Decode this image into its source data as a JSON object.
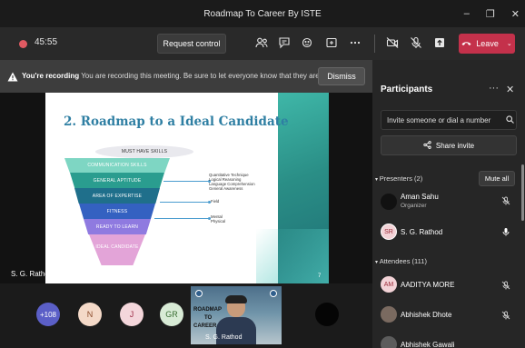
{
  "window": {
    "title": "Roadmap To Career By ISTE",
    "controls": [
      "–",
      "❐",
      "✕"
    ]
  },
  "toolbar": {
    "timer": "45:55",
    "request_control": "Request control",
    "leave_label": "Leave",
    "icons": [
      "participants-icon",
      "chat-icon",
      "reactions-icon",
      "share-tray-icon",
      "more-icon",
      "camera-off-icon",
      "mic-off-icon",
      "share-icon"
    ]
  },
  "banner": {
    "bold": "You're recording",
    "text": " You are recording this meeting. Be sure to let everyone know that they are...",
    "dismiss": "Dismiss"
  },
  "slide": {
    "title": "2. Roadmap to a Ideal Candidate",
    "page": "7",
    "funnel": [
      "MUST HAVE SKILLS",
      "COMMUNICATION SKILLS",
      "GENERAL APTITUDE",
      "AREA OF EXPERTISE",
      "FITNESS",
      "READY TO LEARN",
      "IDEAL CANDIDATE"
    ],
    "notes": [
      [
        "Quantitative Technique",
        "Logical Reasoning",
        "Language Comprehension",
        "General Awareness"
      ],
      [
        "Field"
      ],
      [
        "Mental",
        "Physical"
      ]
    ]
  },
  "stage": {
    "presenter": "S. G. Rathod"
  },
  "panel": {
    "title": "Participants",
    "invite_placeholder": "Invite someone or dial a number",
    "share_invite": "Share invite",
    "presenters_head": "Presenters (2)",
    "mute_all": "Mute all",
    "attendees_head": "Attendees (111)",
    "presenters": [
      {
        "name": "Aman Sahu",
        "role": "Organizer",
        "initials": ""
      },
      {
        "name": "S. G. Rathod",
        "role": "",
        "initials": "SR"
      }
    ],
    "attendees": [
      {
        "name": "AADITYA MORE",
        "initials": "AM"
      },
      {
        "name": "Abhishek Dhote",
        "initials": ""
      },
      {
        "name": "Abhishek Gawali",
        "initials": ""
      }
    ]
  },
  "strip": {
    "avatars": [
      "+108",
      "N",
      "J",
      "GR"
    ],
    "tile_label": "S. G. Rathod",
    "tile_text": [
      "ROADMAP",
      "TO",
      "CAREER"
    ]
  },
  "colors": {
    "leave": "#c4314b",
    "accent": "#6264a7",
    "slide_title": "#2f7fa3"
  }
}
